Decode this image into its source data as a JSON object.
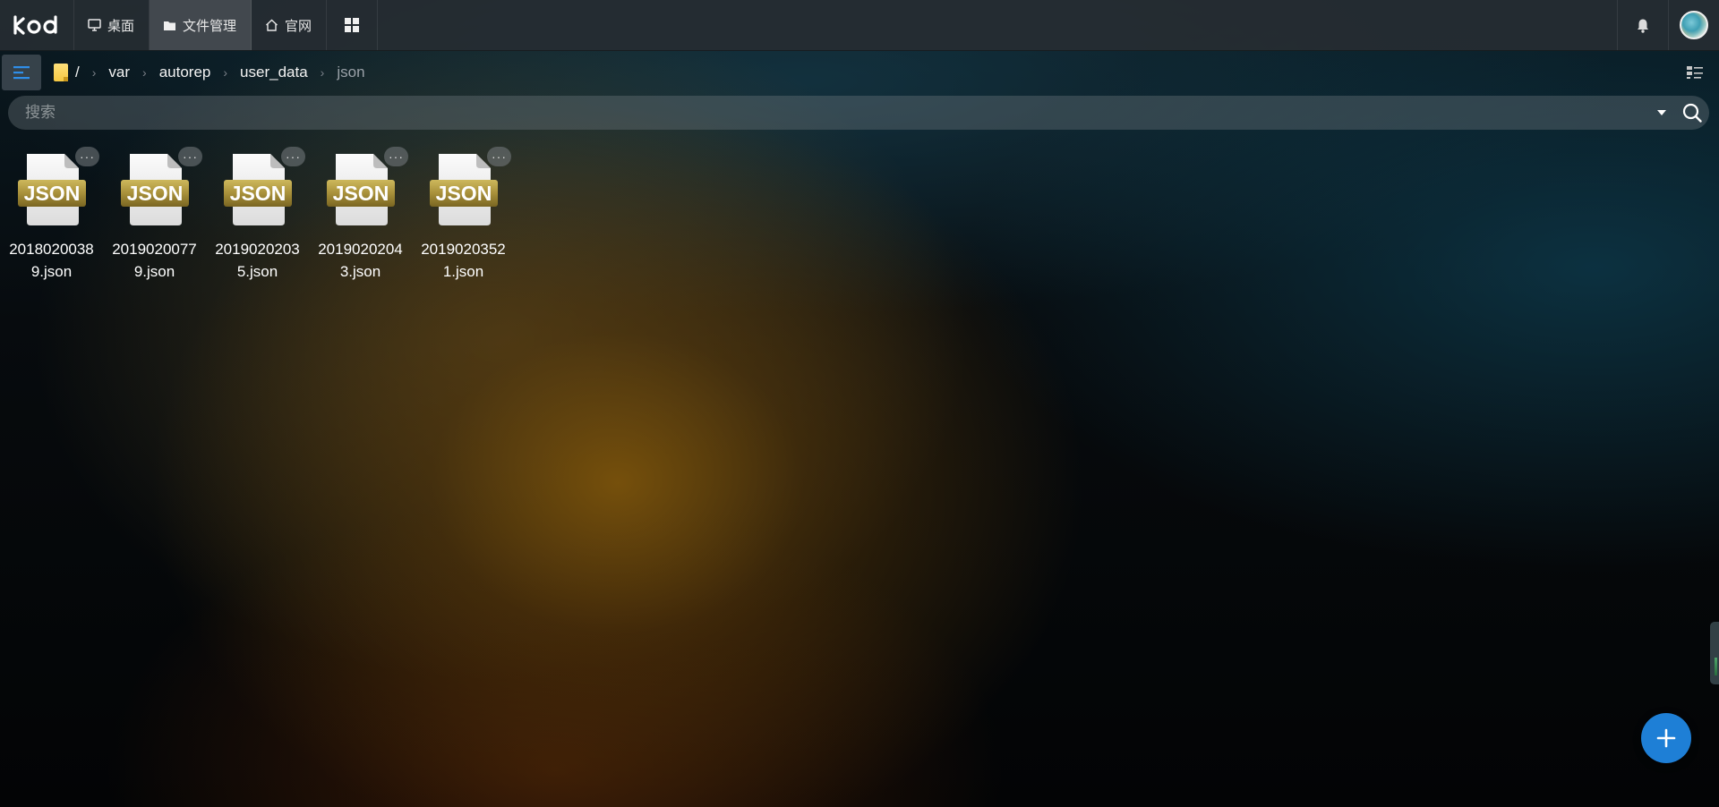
{
  "app": {
    "logo_text": "KOD"
  },
  "nav": {
    "items": [
      {
        "label": "桌面",
        "icon": "monitor-icon",
        "active": false
      },
      {
        "label": "文件管理",
        "icon": "folder-icon",
        "active": true
      },
      {
        "label": "官网",
        "icon": "home-icon",
        "active": false
      }
    ],
    "apps_icon": "apps-grid-icon"
  },
  "header_right": {
    "notification_icon": "bell-icon",
    "avatar_icon": "avatar"
  },
  "breadcrumb": {
    "root_label": "/",
    "items": [
      {
        "label": "var"
      },
      {
        "label": "autorep"
      },
      {
        "label": "user_data"
      },
      {
        "label": "json"
      }
    ],
    "separator": "›"
  },
  "search": {
    "placeholder": "搜索",
    "value": ""
  },
  "files": [
    {
      "name": "20180200389.json",
      "type": "JSON",
      "more": "···"
    },
    {
      "name": "20190200779.json",
      "type": "JSON",
      "more": "···"
    },
    {
      "name": "20190202035.json",
      "type": "JSON",
      "more": "···"
    },
    {
      "name": "20190202043.json",
      "type": "JSON",
      "more": "···"
    },
    {
      "name": "20190203521.json",
      "type": "JSON",
      "more": "···"
    }
  ],
  "colors": {
    "accent": "#1e7fd6",
    "label_gold": "#b39a3a"
  }
}
